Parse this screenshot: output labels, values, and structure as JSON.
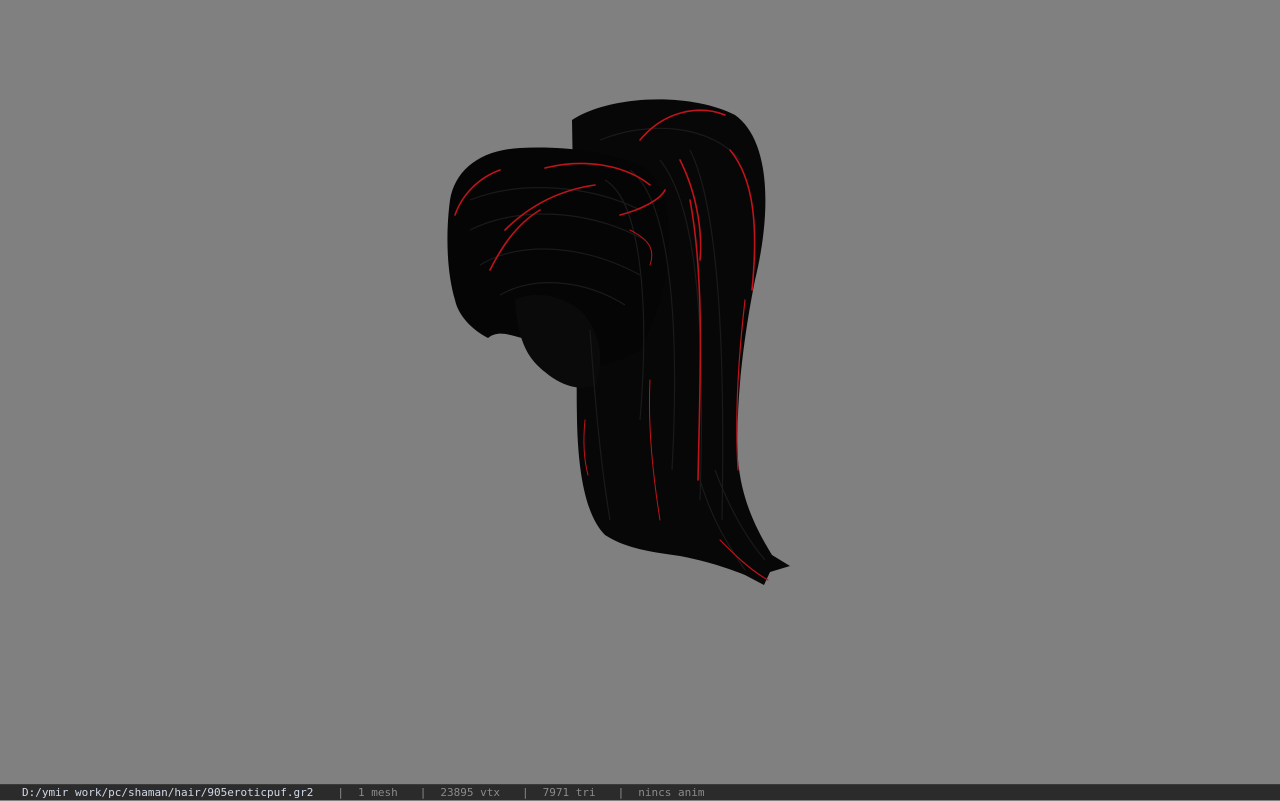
{
  "status_bar": {
    "file_path": "D:/ymir work/pc/shaman/hair/905eroticpuf.gr2",
    "separator": "|",
    "mesh_count": "1 mesh",
    "vertex_count": "23895 vtx",
    "triangle_count": "7971 tri",
    "animation": "nincs anim"
  },
  "viewport": {
    "background_color": "#808080",
    "model_color": "#060606",
    "highlight_color": "#c0131a"
  }
}
